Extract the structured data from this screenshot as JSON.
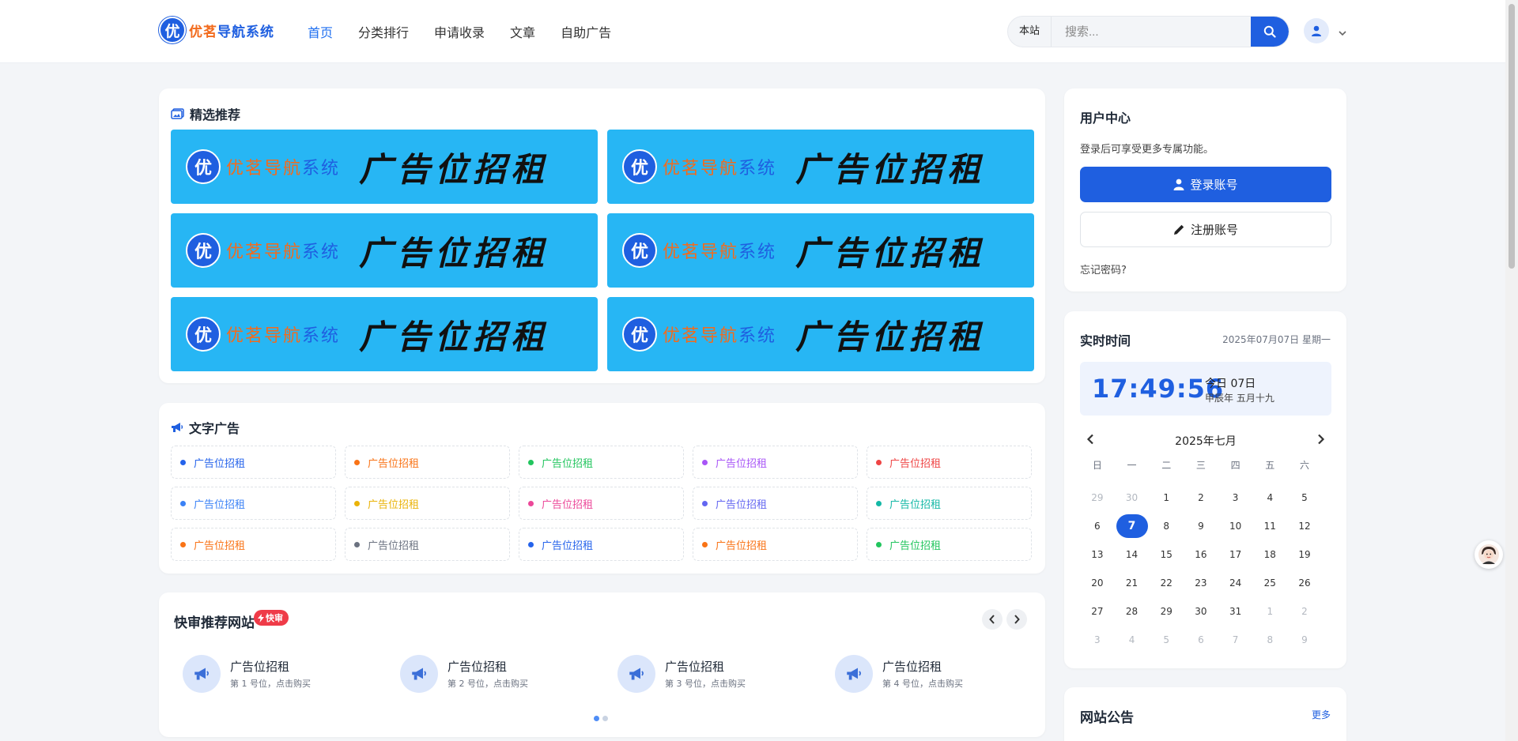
{
  "header": {
    "logo_mark": "优",
    "logo_text_1": "优茗",
    "logo_text_2": "导航系统",
    "nav": [
      {
        "label": "首页",
        "active": true
      },
      {
        "label": "分类排行"
      },
      {
        "label": "申请收录"
      },
      {
        "label": "文章"
      },
      {
        "label": "自助广告"
      }
    ],
    "search_scope": "本站",
    "search_placeholder": "搜索...",
    "accent": "#1f5fe0"
  },
  "featured": {
    "title": "精选推荐",
    "banners": [
      {
        "mark": "优",
        "brand_1": "优茗",
        "brand_2": "导航",
        "brand_3": "系统",
        "cta": "广告位招租"
      },
      {
        "mark": "优",
        "brand_1": "优茗",
        "brand_2": "导航",
        "brand_3": "系统",
        "cta": "广告位招租"
      },
      {
        "mark": "优",
        "brand_1": "优茗",
        "brand_2": "导航",
        "brand_3": "系统",
        "cta": "广告位招租"
      },
      {
        "mark": "优",
        "brand_1": "优茗",
        "brand_2": "导航",
        "brand_3": "系统",
        "cta": "广告位招租"
      },
      {
        "mark": "优",
        "brand_1": "优茗",
        "brand_2": "导航",
        "brand_3": "系统",
        "cta": "广告位招租"
      },
      {
        "mark": "优",
        "brand_1": "优茗",
        "brand_2": "导航",
        "brand_3": "系统",
        "cta": "广告位招租"
      }
    ]
  },
  "text_ads": {
    "title": "文字广告",
    "items": [
      {
        "label": "广告位招租",
        "color": "#2563eb"
      },
      {
        "label": "广告位招租",
        "color": "#f97316"
      },
      {
        "label": "广告位招租",
        "color": "#22c55e"
      },
      {
        "label": "广告位招租",
        "color": "#a855f7"
      },
      {
        "label": "广告位招租",
        "color": "#ef4444"
      },
      {
        "label": "广告位招租",
        "color": "#3b82f6"
      },
      {
        "label": "广告位招租",
        "color": "#eab308"
      },
      {
        "label": "广告位招租",
        "color": "#ec4899"
      },
      {
        "label": "广告位招租",
        "color": "#6366f1"
      },
      {
        "label": "广告位招租",
        "color": "#14b8a6"
      },
      {
        "label": "广告位招租",
        "color": "#f97316"
      },
      {
        "label": "广告位招租",
        "color": "#6b7280"
      },
      {
        "label": "广告位招租",
        "color": "#2563eb"
      },
      {
        "label": "广告位招租",
        "color": "#f97316"
      },
      {
        "label": "广告位招租",
        "color": "#22c55e"
      }
    ]
  },
  "quick": {
    "title": "快审推荐网站",
    "badge": "快审",
    "items": [
      {
        "name": "广告位招租",
        "sub": "第 1 号位，点击购买"
      },
      {
        "name": "广告位招租",
        "sub": "第 2 号位，点击购买"
      },
      {
        "name": "广告位招租",
        "sub": "第 3 号位，点击购买"
      },
      {
        "name": "广告位招租",
        "sub": "第 4 号位，点击购买"
      }
    ]
  },
  "user_center": {
    "title": "用户中心",
    "desc": "登录后可享受更多专属功能。",
    "login": "登录账号",
    "register": "注册账号",
    "forgot": "忘记密码?"
  },
  "time": {
    "title": "实时时间",
    "date": "2025年07月07日 星期一",
    "clock": "17:49:56",
    "today": "今日 07日",
    "lunar": "甲辰年 五月十九",
    "month": "2025年七月",
    "weekdays": [
      "日",
      "一",
      "二",
      "三",
      "四",
      "五",
      "六"
    ],
    "days": [
      {
        "d": "29",
        "m": true
      },
      {
        "d": "30",
        "m": true
      },
      {
        "d": "1"
      },
      {
        "d": "2"
      },
      {
        "d": "3"
      },
      {
        "d": "4"
      },
      {
        "d": "5"
      },
      {
        "d": "6"
      },
      {
        "d": "7",
        "t": true
      },
      {
        "d": "8"
      },
      {
        "d": "9"
      },
      {
        "d": "10"
      },
      {
        "d": "11"
      },
      {
        "d": "12"
      },
      {
        "d": "13"
      },
      {
        "d": "14"
      },
      {
        "d": "15"
      },
      {
        "d": "16"
      },
      {
        "d": "17"
      },
      {
        "d": "18"
      },
      {
        "d": "19"
      },
      {
        "d": "20"
      },
      {
        "d": "21"
      },
      {
        "d": "22"
      },
      {
        "d": "23"
      },
      {
        "d": "24"
      },
      {
        "d": "25"
      },
      {
        "d": "26"
      },
      {
        "d": "27"
      },
      {
        "d": "28"
      },
      {
        "d": "29"
      },
      {
        "d": "30"
      },
      {
        "d": "31"
      },
      {
        "d": "1",
        "m": true
      },
      {
        "d": "2",
        "m": true
      },
      {
        "d": "3",
        "m": true
      },
      {
        "d": "4",
        "m": true
      },
      {
        "d": "5",
        "m": true
      },
      {
        "d": "6",
        "m": true
      },
      {
        "d": "7",
        "m": true
      },
      {
        "d": "8",
        "m": true
      },
      {
        "d": "9",
        "m": true
      }
    ]
  },
  "notice": {
    "title": "网站公告",
    "more": "更多"
  }
}
